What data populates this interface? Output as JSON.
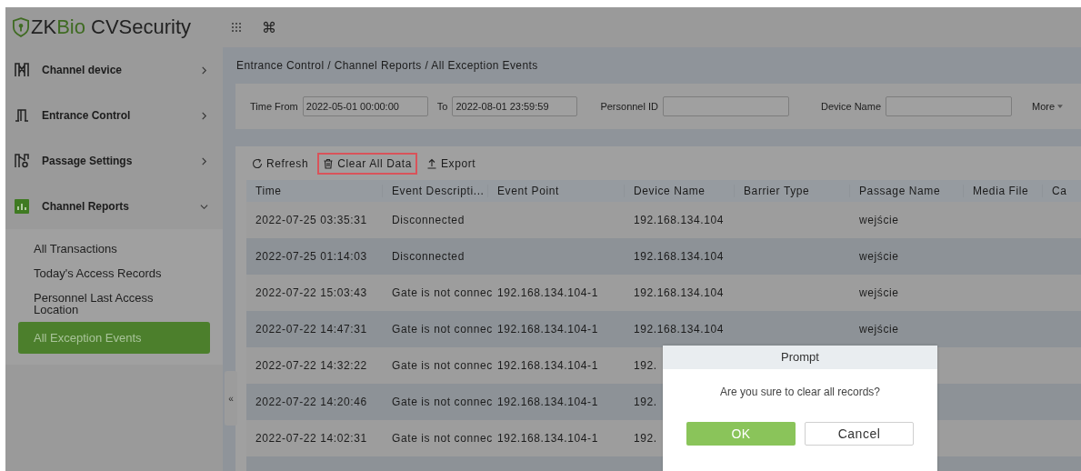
{
  "header": {
    "logo": [
      "ZK",
      "Bio",
      "CVSecurity"
    ],
    "shortcut": "⌘"
  },
  "sidebar": {
    "items": [
      {
        "label": "Channel device",
        "kind": "gate",
        "expanded": false
      },
      {
        "label": "Entrance Control",
        "kind": "door",
        "expanded": false
      },
      {
        "label": "Passage Settings",
        "kind": "settings",
        "expanded": false
      },
      {
        "label": "Channel Reports",
        "kind": "chart",
        "expanded": true,
        "children": [
          {
            "label": "All Transactions",
            "selected": false
          },
          {
            "label": "Today's Access Records",
            "selected": false
          },
          {
            "label": "Personnel Last Access Location",
            "selected": false
          },
          {
            "label": "All Exception Events",
            "selected": true
          }
        ]
      }
    ],
    "collapse": "«"
  },
  "breadcrumb": "Entrance Control / Channel Reports / All Exception Events",
  "filters": [
    {
      "label": "Time From",
      "value": "2022-05-01 00:00:00"
    },
    {
      "label": "To",
      "value": "2022-08-01 23:59:59"
    },
    {
      "label": "Personnel ID"
    },
    {
      "label": "Device Name"
    }
  ],
  "more": "More",
  "toolbar": [
    {
      "label": "Refresh",
      "kind": "refresh",
      "highlighted": false
    },
    {
      "label": "Clear All Data",
      "kind": "trash",
      "highlighted": true
    },
    {
      "label": "Export",
      "kind": "export",
      "highlighted": false
    }
  ],
  "table": {
    "columns": [
      "Time",
      "Event Descripti...",
      "Event Point",
      "Device Name",
      "Barrier Type",
      "Passage Name",
      "Media File",
      "Ca"
    ],
    "rows": [
      [
        "2022-07-25 03:35:31",
        "Disconnected",
        "",
        "192.168.134.104",
        "",
        "wejście",
        "",
        ""
      ],
      [
        "2022-07-25 01:14:03",
        "Disconnected",
        "",
        "192.168.134.104",
        "",
        "wejście",
        "",
        ""
      ],
      [
        "2022-07-22 15:03:43",
        "Gate is not connec",
        "192.168.134.104-1",
        "192.168.134.104",
        "",
        "wejście",
        "",
        ""
      ],
      [
        "2022-07-22 14:47:31",
        "Gate is not connec",
        "192.168.134.104-1",
        "192.168.134.104",
        "",
        "wejście",
        "",
        ""
      ],
      [
        "2022-07-22 14:32:22",
        "Gate is not connec",
        "192.168.134.104-1",
        "192.",
        "",
        "",
        "",
        ""
      ],
      [
        "2022-07-22 14:20:46",
        "Gate is not connec",
        "192.168.134.104-1",
        "192.",
        "",
        "",
        "",
        ""
      ],
      [
        "2022-07-22 14:02:31",
        "Gate is not connec",
        "192.168.134.104-1",
        "192.",
        "",
        "",
        "",
        ""
      ]
    ]
  },
  "dialog": {
    "title": "Prompt",
    "message": "Are you sure to clear all records?",
    "buttons": [
      {
        "label": "OK",
        "kind": "primary"
      },
      {
        "label": "Cancel",
        "kind": "secondary"
      }
    ]
  }
}
